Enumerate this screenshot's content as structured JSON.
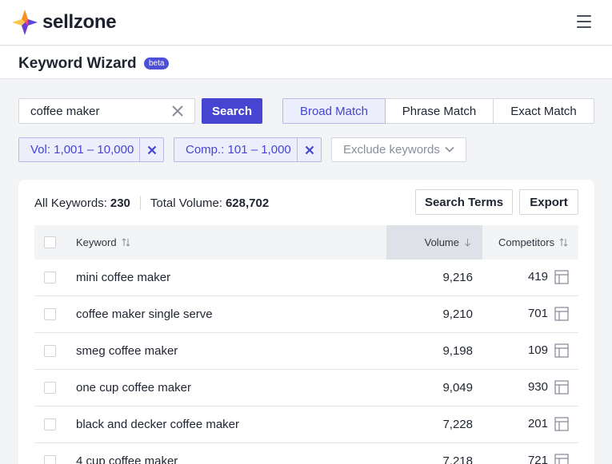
{
  "brand": {
    "name": "sellzone",
    "colors": {
      "orange": "#f7931e",
      "purple": "#5b4ad8",
      "pink": "#e64a8a",
      "yellow": "#f9c74f"
    }
  },
  "header": {
    "menu_icon": "hamburger-icon"
  },
  "page": {
    "title": "Keyword Wizard",
    "badge": "beta"
  },
  "search": {
    "value": "coffee maker",
    "placeholder": "",
    "button_label": "Search",
    "clear_icon": "close-icon"
  },
  "match_tabs": [
    {
      "label": "Broad Match",
      "active": true
    },
    {
      "label": "Phrase Match",
      "active": false
    },
    {
      "label": "Exact Match",
      "active": false
    }
  ],
  "filters": {
    "volume": "Vol: 1,001 – 10,000",
    "competitors": "Comp.: 101 – 1,000",
    "exclude_label": "Exclude keywords"
  },
  "stats": {
    "all_keywords_label": "All Keywords:",
    "all_keywords_value": "230",
    "total_volume_label": "Total Volume:",
    "total_volume_value": "628,702"
  },
  "actions": {
    "search_terms": "Search Terms",
    "export": "Export"
  },
  "table": {
    "columns": {
      "keyword": "Keyword",
      "volume": "Volume",
      "competitors": "Competitors"
    },
    "sorted_column": "volume",
    "rows": [
      {
        "keyword": "mini coffee maker",
        "volume": "9,216",
        "competitors": "419"
      },
      {
        "keyword": "coffee maker single serve",
        "volume": "9,210",
        "competitors": "701"
      },
      {
        "keyword": "smeg coffee maker",
        "volume": "9,198",
        "competitors": "109"
      },
      {
        "keyword": "one cup coffee maker",
        "volume": "9,049",
        "competitors": "930"
      },
      {
        "keyword": "black and decker coffee maker",
        "volume": "7,228",
        "competitors": "201"
      },
      {
        "keyword": "4 cup coffee maker",
        "volume": "7,218",
        "competitors": "721"
      }
    ]
  },
  "accent": "#4545d1"
}
